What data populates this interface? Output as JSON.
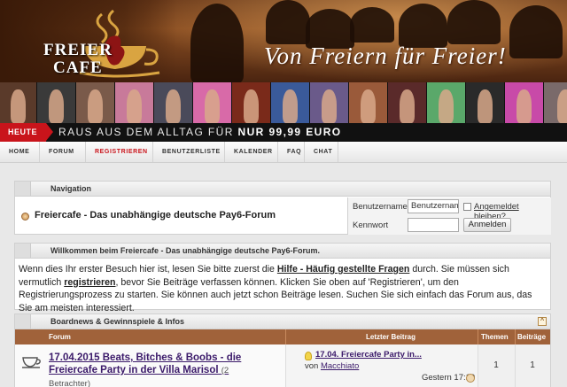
{
  "header": {
    "logo_line1": "FREIER",
    "logo_line2": "CAFE",
    "slogan": "Von Freiern für Freier!"
  },
  "ticker": {
    "badge": "HEUTE",
    "text": "RAUS AUS DEM ALLTAG FÜR",
    "price": "NUR 99,99 EURO"
  },
  "nav": {
    "tabs": [
      {
        "label": "Home"
      },
      {
        "label": "Forum"
      },
      {
        "label": "Registrieren"
      },
      {
        "label": "Benutzerliste"
      },
      {
        "label": "Kalender"
      },
      {
        "label": "FAQ"
      },
      {
        "label": "Chat"
      }
    ]
  },
  "navigation": {
    "title": "Navigation",
    "site_title": "Freiercafe - Das unabhängige deutsche Pay6-Forum",
    "login": {
      "username_label": "Benutzername",
      "username_value": "Benutzername",
      "remember_label": "Angemeldet bleiben?",
      "password_label": "Kennwort",
      "login_button": "Anmelden"
    }
  },
  "welcome": {
    "title": "Willkommen beim Freiercafe - Das unabhängige deutsche Pay6-Forum.",
    "p1": "Wenn dies Ihr erster Besuch hier ist, lesen Sie bitte zuerst die",
    "faq_link": "Hilfe - Häufig gestellte Fragen",
    "p2": "durch. Sie müssen sich vermutlich",
    "register_link": "registrieren",
    "p3": ", bevor Sie Beiträge verfassen können. Klicken Sie oben auf 'Registrieren', um den Registrierungsprozess zu starten. Sie können auch jetzt schon Beiträge lesen. Suchen Sie sich einfach das Forum aus, das Sie am meisten interessiert."
  },
  "forum": {
    "category": "Boardnews & Gewinnspiele & Infos",
    "columns": {
      "forum": "Forum",
      "last_post": "Letzter Beitrag",
      "threads": "Themen",
      "posts": "Beiträge"
    },
    "rows": [
      {
        "name": "17.04.2015 Beats, Bitches & Boobs - die Freiercafe Party in der Villa Marisol",
        "viewers": "(2 Betrachter)",
        "last_title": "17.04. Freiercafe Party in...",
        "last_by_prefix": "von",
        "last_by_user": "Macchiato",
        "last_time": "Gestern 17:10",
        "threads": "1",
        "posts": "1"
      }
    ]
  },
  "colors": {
    "accent": "#c9141b",
    "table_header": "#a0623a",
    "link": "#3b1a6a"
  }
}
